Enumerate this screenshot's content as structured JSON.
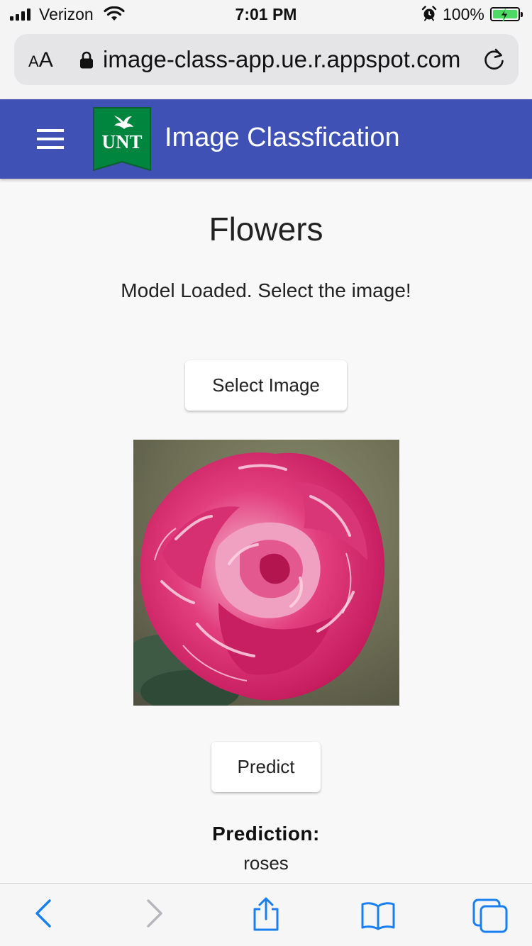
{
  "status_bar": {
    "carrier": "Verizon",
    "time": "7:01 PM",
    "battery": "100%"
  },
  "browser": {
    "text_size_label": "AA",
    "url": "image-class-app.ue.r.appspot.com"
  },
  "app_bar": {
    "logo_text": "UNT",
    "title": "Image Classfication"
  },
  "main": {
    "heading": "Flowers",
    "status_message": "Model Loaded. Select the image!",
    "select_button_label": "Select Image",
    "predict_button_label": "Predict",
    "prediction_label": "Prediction:",
    "prediction_value": "roses"
  },
  "colors": {
    "app_bar": "#3f51b5",
    "logo_green": "#00853e",
    "ios_blue": "#1a7ff0",
    "battery_green": "#4cd964"
  },
  "icons": {
    "menu": "hamburger-icon",
    "back": "chevron-left-icon",
    "forward": "chevron-right-icon",
    "share": "share-icon",
    "bookmarks": "book-icon",
    "tabs": "tabs-icon"
  }
}
